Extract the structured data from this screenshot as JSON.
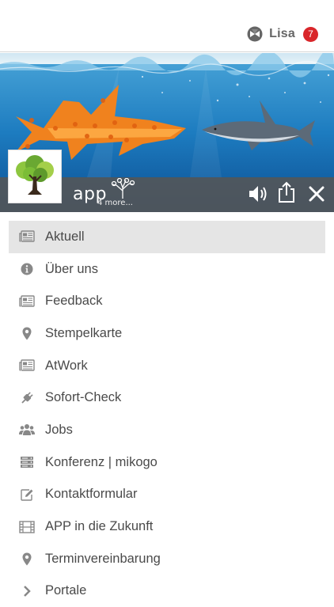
{
  "header": {
    "user_name": "Lisa",
    "notification_count": "7",
    "badge_color": "#d9262a"
  },
  "banner": {
    "brand": "app",
    "brand_sub": "4 more..."
  },
  "menu": {
    "active_index": 0,
    "items": [
      {
        "label": "Aktuell",
        "icon": "newspaper-icon"
      },
      {
        "label": "Über uns",
        "icon": "info-icon"
      },
      {
        "label": "Feedback",
        "icon": "newspaper-icon"
      },
      {
        "label": "Stempelkarte",
        "icon": "map-marker-icon"
      },
      {
        "label": "AtWork",
        "icon": "newspaper-icon"
      },
      {
        "label": "Sofort-Check",
        "icon": "plug-icon"
      },
      {
        "label": "Jobs",
        "icon": "users-icon"
      },
      {
        "label": "Konferenz | mikogo",
        "icon": "server-icon"
      },
      {
        "label": "Kontaktformular",
        "icon": "edit-icon"
      },
      {
        "label": "APP in die Zukunft",
        "icon": "film-icon"
      },
      {
        "label": "Terminvereinbarung",
        "icon": "map-marker-icon"
      },
      {
        "label": "Portale",
        "icon": "chevron-right-icon"
      }
    ]
  }
}
